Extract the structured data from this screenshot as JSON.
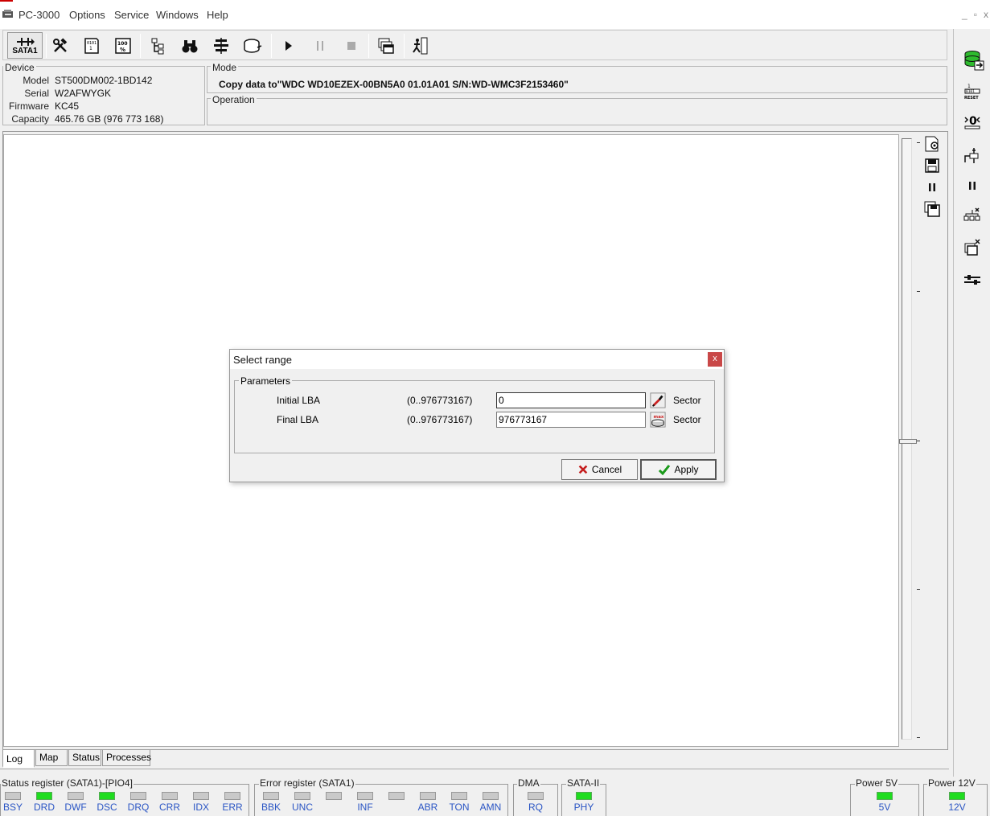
{
  "app": {
    "title": "PC-3000",
    "menus": [
      "Options",
      "Service",
      "Windows",
      "Help"
    ],
    "window_controls": [
      "_",
      "▫",
      "x"
    ]
  },
  "toolbar": {
    "sata_label": "SATA1"
  },
  "device": {
    "group_label": "Device",
    "model_key": "Model",
    "model": "ST500DM002-1BD142",
    "serial_key": "Serial",
    "serial": "W2AFWYGK",
    "firmware_key": "Firmware",
    "firmware": "KC45",
    "capacity_key": "Capacity",
    "capacity": "465.76 GB (976 773 168)"
  },
  "mode": {
    "group_label": "Mode",
    "text": "Copy data to\"WDC WD10EZEX-00BN5A0 01.01A01 S/N:WD-WMC3F2153460\""
  },
  "operation": {
    "group_label": "Operation"
  },
  "tabs": [
    {
      "label": "Log",
      "active": true
    },
    {
      "label": "Map",
      "active": false
    },
    {
      "label": "Status",
      "active": false
    },
    {
      "label": "Processes",
      "active": false
    }
  ],
  "status_register": {
    "label": "Status register (SATA1)-[PIO4]",
    "leds": [
      {
        "name": "BSY",
        "on": false
      },
      {
        "name": "DRD",
        "on": true
      },
      {
        "name": "DWF",
        "on": false
      },
      {
        "name": "DSC",
        "on": true
      },
      {
        "name": "DRQ",
        "on": false
      },
      {
        "name": "CRR",
        "on": false
      },
      {
        "name": "IDX",
        "on": false
      },
      {
        "name": "ERR",
        "on": false
      }
    ]
  },
  "error_register": {
    "label": "Error register (SATA1)",
    "leds": [
      {
        "name": "BBK",
        "on": false
      },
      {
        "name": "UNC",
        "on": false
      },
      {
        "name": "",
        "on": false
      },
      {
        "name": "INF",
        "on": false
      },
      {
        "name": "",
        "on": false
      },
      {
        "name": "ABR",
        "on": false
      },
      {
        "name": "TON",
        "on": false
      },
      {
        "name": "AMN",
        "on": false
      }
    ]
  },
  "dma": {
    "label": "DMA",
    "led": "RQ",
    "on": false
  },
  "sata2": {
    "label": "SATA-II",
    "led": "PHY",
    "on": true
  },
  "power5": {
    "label": "Power 5V",
    "led": "5V",
    "on": true
  },
  "power12": {
    "label": "Power 12V",
    "led": "12V",
    "on": true
  },
  "dialog": {
    "title": "Select range",
    "close": "x",
    "group_label": "Parameters",
    "initial": {
      "label": "Initial LBA",
      "range": "(0..976773167)",
      "value": "0",
      "unit": "Sector"
    },
    "final": {
      "label": "Final  LBA",
      "range": "(0..976773167)",
      "value": "976773167",
      "unit": "Sector"
    },
    "cancel_label": "Cancel",
    "apply_label": "Apply",
    "max_label": "max"
  },
  "colors": {
    "led_on": "#1fdc1f",
    "led_off": "#c9c9c9",
    "led_label": "#2a55c4",
    "close_button": "#c94848"
  }
}
